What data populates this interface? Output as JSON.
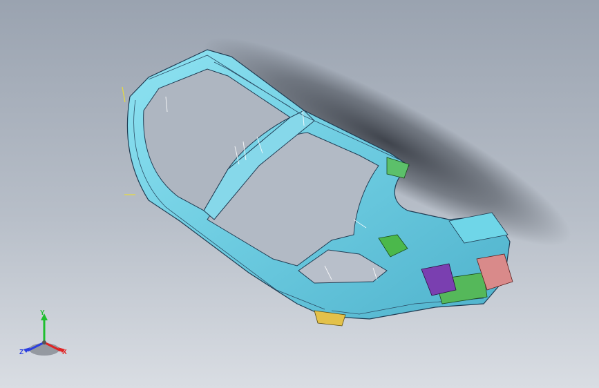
{
  "viewport": {
    "background_top": "#9aa3b0",
    "background_bottom": "#d9dde3",
    "model_color": "#7fd3e6",
    "model_edge_color": "#1f3b52",
    "shadow_color": "#3a3f47"
  },
  "axis_triad": {
    "y_label": "Y",
    "x_label": "X",
    "z_label": "Z",
    "y_color": "#1fbf2f",
    "x_color": "#e02424",
    "z_color": "#2b3fe0"
  },
  "components": [
    {
      "name": "green-bracket",
      "color": "#4bb84b"
    },
    {
      "name": "purple-bracket",
      "color": "#7a3fb0"
    },
    {
      "name": "pink-housing",
      "color": "#d98a8a"
    },
    {
      "name": "yellow-mount",
      "color": "#e3c14a"
    }
  ]
}
